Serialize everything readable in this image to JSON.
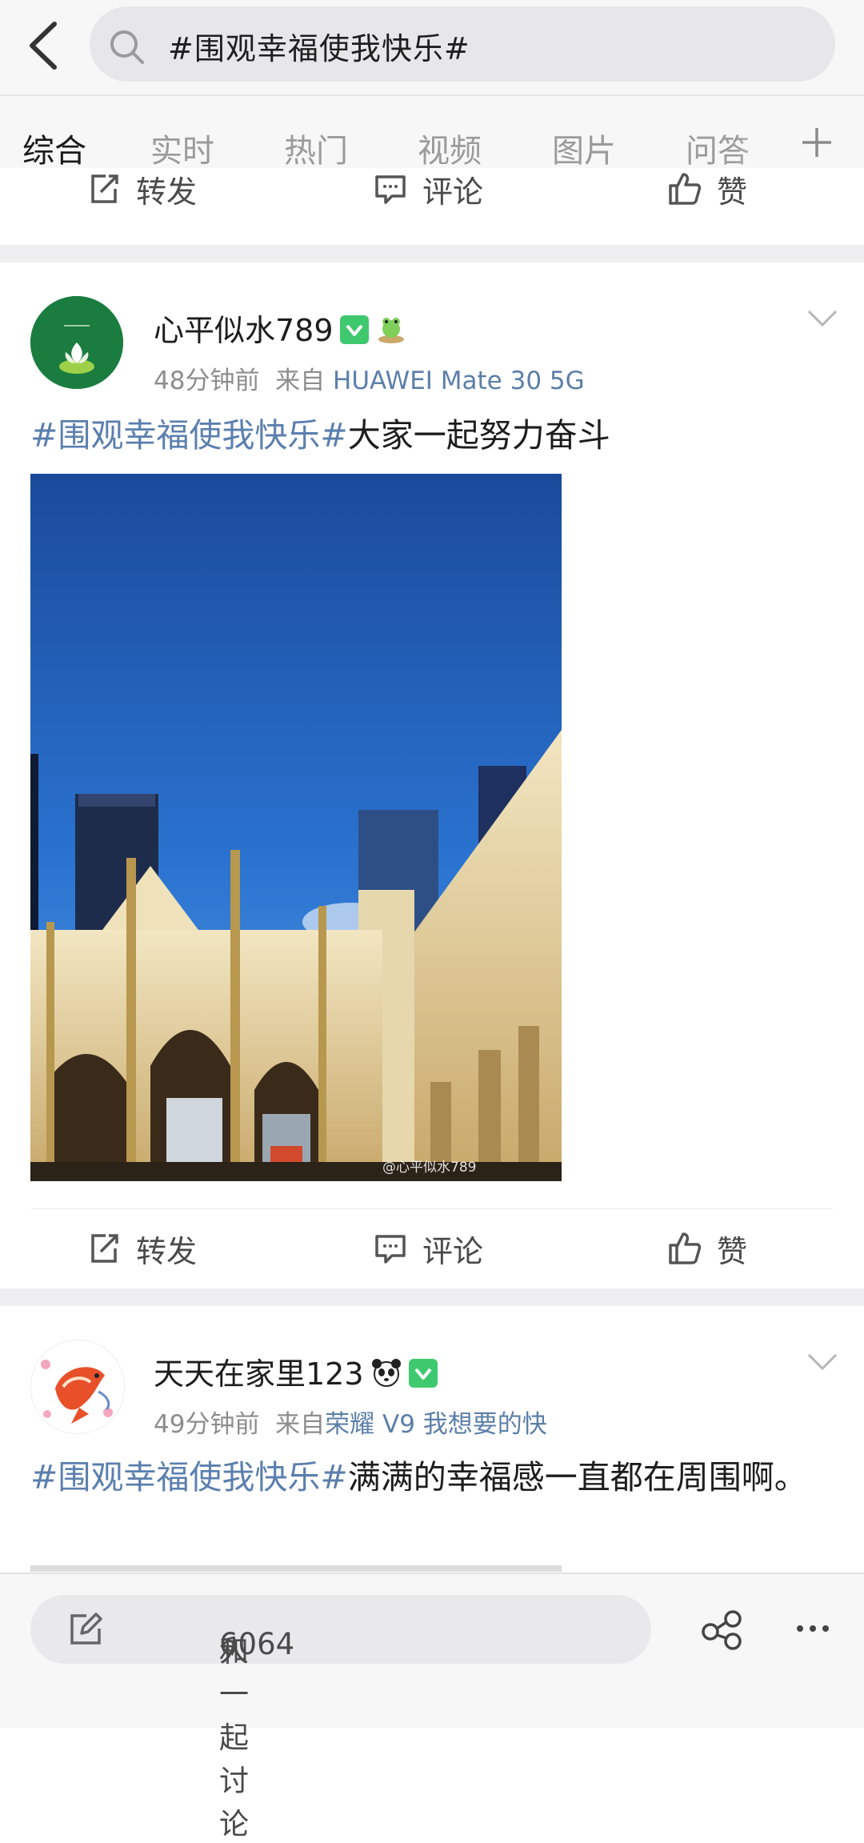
{
  "search": {
    "query": "#围观幸福使我快乐#"
  },
  "tabs": [
    {
      "label": "综合",
      "active": true
    },
    {
      "label": "实时"
    },
    {
      "label": "热门"
    },
    {
      "label": "视频"
    },
    {
      "label": "图片"
    },
    {
      "label": "问答"
    }
  ],
  "actions": {
    "repost": "转发",
    "comment": "评论",
    "like": "赞"
  },
  "posts": [
    {
      "username": "心平似水789",
      "time": "48分钟前",
      "from_label": "来自",
      "source": "HUAWEI Mate 30 5G",
      "topic": "#围观幸福使我快乐#",
      "text": "大家一起努力奋斗",
      "image_watermark": "@心平似水789"
    },
    {
      "username": "天天在家里123",
      "time": "49分钟前",
      "from_label": "来自",
      "source": "荣耀 V9 我想要的快",
      "topic": "#围观幸福使我快乐#",
      "text": "满满的幸福感一直都在周围啊。"
    }
  ],
  "bottom": {
    "discuss_prefix": "和",
    "discuss_count": "6064",
    "discuss_suffix": "人一起讨论"
  },
  "colors": {
    "accent": "#ff8a00",
    "link": "#5b7fae",
    "verified": "#3fc96f"
  }
}
